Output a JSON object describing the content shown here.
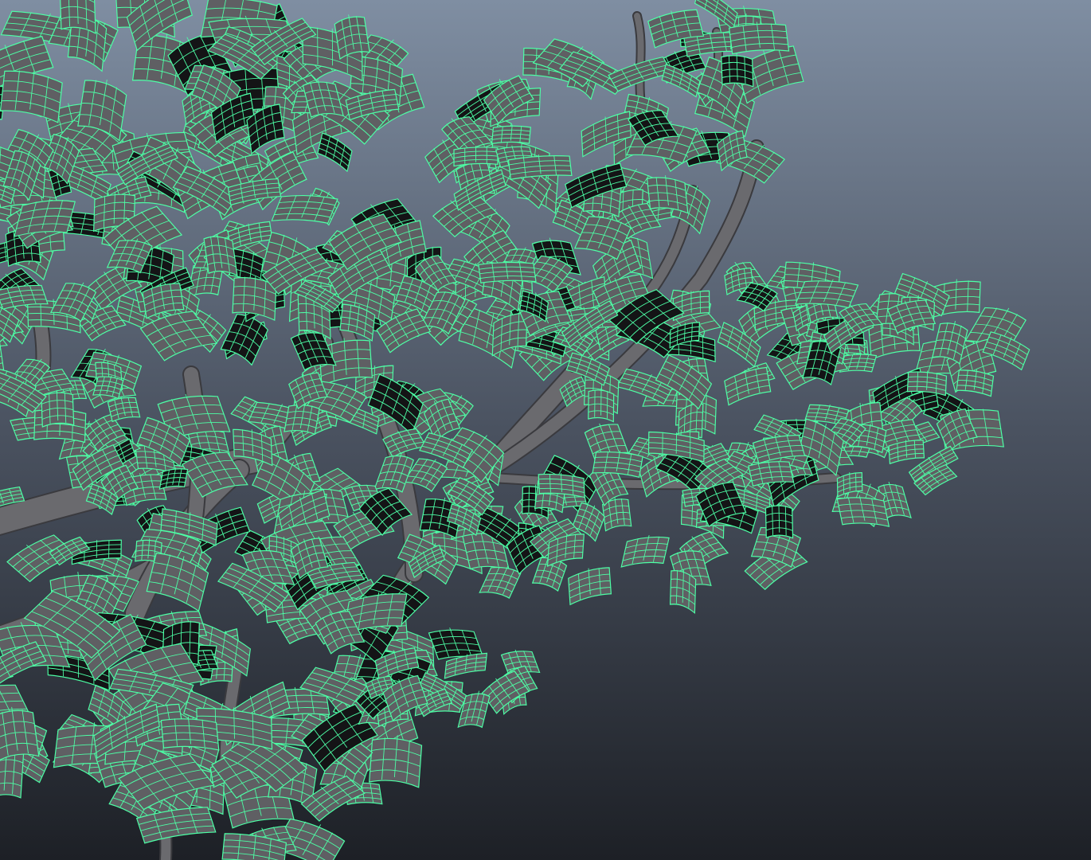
{
  "viewport": {
    "background_top": "#7f8ea2",
    "background_mid": "#4a5260",
    "background_bottom": "#1d2026",
    "wire_color": "#4dffa6",
    "leaf_fill": "#5f5f63",
    "leaf_dark_fill": "#141416",
    "branch_color": "#6a6a6e",
    "branch_shadow": "#3a3a3e"
  }
}
